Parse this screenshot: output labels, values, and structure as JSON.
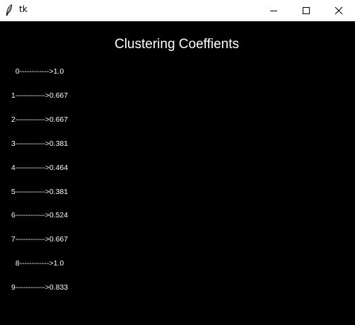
{
  "window": {
    "title": "tk",
    "icon": "feather-icon",
    "controls": [
      "minimize-icon",
      "maximize-icon",
      "close-icon"
    ],
    "background": "#000000"
  },
  "main": {
    "heading": "Clustering Coeffients",
    "rows": [
      {
        "text": "0------------>1.0"
      },
      {
        "text": "1------------>0.667"
      },
      {
        "text": "2------------>0.667"
      },
      {
        "text": "3------------>0.381"
      },
      {
        "text": "4------------>0.464"
      },
      {
        "text": "5------------>0.381"
      },
      {
        "text": "6------------>0.524"
      },
      {
        "text": "7------------>0.667"
      },
      {
        "text": "8------------>1.0"
      },
      {
        "text": "9------------>0.833"
      }
    ]
  }
}
